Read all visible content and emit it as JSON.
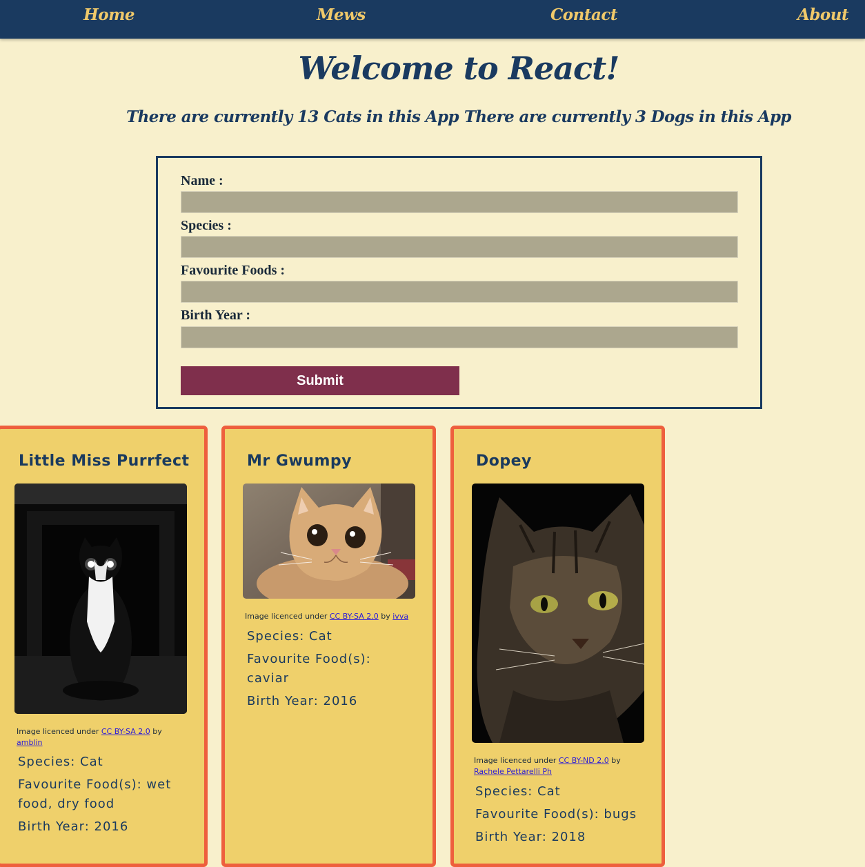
{
  "nav": {
    "items": [
      {
        "label": "Home"
      },
      {
        "label": "Mews"
      },
      {
        "label": "Contact"
      },
      {
        "label": "About"
      }
    ]
  },
  "header": {
    "title": "Welcome to React!",
    "cat_count_text": "There are currently 13 Cats in this App",
    "dog_count_text": "There are currently 3 Dogs in this App"
  },
  "form": {
    "fields": [
      {
        "label": "Name :",
        "value": "",
        "placeholder": ""
      },
      {
        "label": "Species :",
        "value": "",
        "placeholder": ""
      },
      {
        "label": "Favourite Foods :",
        "value": "",
        "placeholder": ""
      },
      {
        "label": "Birth Year :",
        "value": "",
        "placeholder": ""
      }
    ],
    "submit_label": "Submit"
  },
  "cards": [
    {
      "name": "Little Miss Purrfect",
      "licence_prefix": "Image licenced under",
      "licence_name": "CC BY-SA 2.0",
      "licence_by": "by",
      "author": "amblin",
      "species": "Species: Cat",
      "foods": "Favourite Food(s): wet food, dry food",
      "birth_year": "Birth Year: 2016"
    },
    {
      "name": "Mr Gwumpy",
      "licence_prefix": "Image licenced under",
      "licence_name": "CC BY-SA 2.0",
      "licence_by": "by",
      "author": "ivva",
      "species": "Species: Cat",
      "foods": "Favourite Food(s): caviar",
      "birth_year": "Birth Year: 2016"
    },
    {
      "name": "Dopey",
      "licence_prefix": "Image licenced under",
      "licence_name": "CC BY-ND 2.0",
      "licence_by": "by",
      "author": "Rachele Pettarelli Ph",
      "species": "Species: Cat",
      "foods": "Favourite Food(s): bugs",
      "birth_year": "Birth Year: 2018"
    }
  ],
  "colors": {
    "nav_bg": "#1a3a60",
    "nav_text": "#f0c96a",
    "page_bg": "#f8f0cc",
    "input_bg": "#aca78e",
    "submit_bg": "#7f2f4c",
    "card_bg": "#efd06b",
    "card_border": "#ee5f3d"
  }
}
